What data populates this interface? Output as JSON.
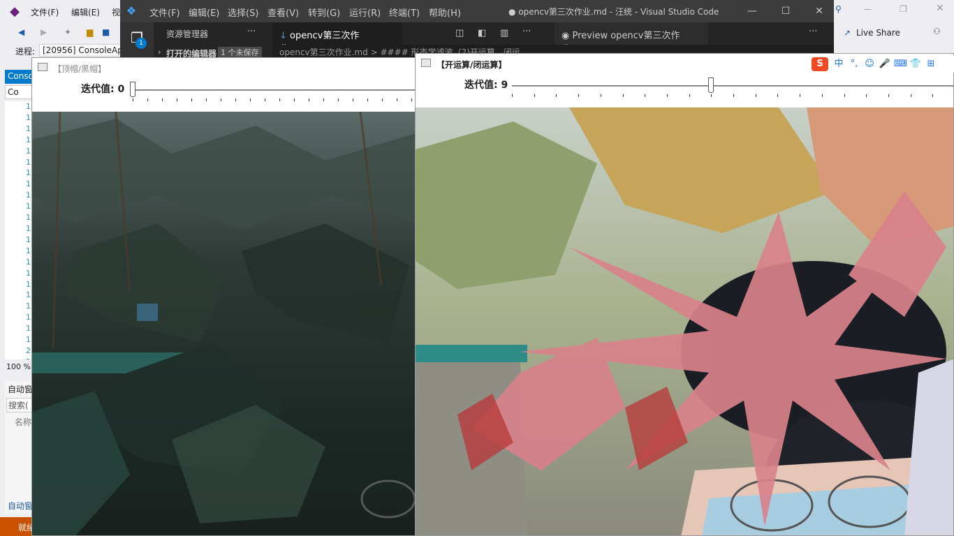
{
  "vs": {
    "menu": [
      "文件(F)",
      "编辑(E)",
      "视"
    ],
    "progress_label": "进程:",
    "process_value": "[20956] ConsoleAp",
    "left_tab": "Conso",
    "left_sub": "Co",
    "line_numbers": [
      "1",
      "1",
      "1",
      "1",
      "1",
      "1",
      "1",
      "1",
      "1",
      "1",
      "1",
      "1",
      "1",
      "1",
      "1",
      "1",
      "1",
      "1",
      "1",
      "1",
      "1",
      "1",
      "2",
      "2"
    ],
    "zoom": "100 %",
    "auto_title": "自动窗",
    "search_placeholder": "搜索(",
    "name_col": "名称",
    "auto_bottom": "自动窗",
    "status_text": "就绪",
    "live_share": "Live Share"
  },
  "vscode": {
    "menu": [
      "文件(F)",
      "编辑(E)",
      "选择(S)",
      "查看(V)",
      "转到(G)",
      "运行(R)",
      "终端(T)",
      "帮助(H)"
    ],
    "window_title": "● opencv第三次作业.md - 汪统 - Visual Studio Code",
    "explorer_label": "资源管理器",
    "open_editors": "打开的编辑器",
    "unsaved_badge": "1 个未保存",
    "activity_badge": "1",
    "tab_active": "opencv第三次作业.md",
    "tab_preview": "Preview opencv第三次作业.md",
    "breadcrumb": "opencv第三次作业.md  >  #### 形态学滤波（2)开运算、闭运",
    "more": "···"
  },
  "windows": {
    "left": {
      "title": "【顶帽/黑帽】",
      "trackbar_label": "迭代值: 0",
      "value": 0,
      "max": 20
    },
    "right": {
      "title": "【开运算/闭运算】",
      "trackbar_label": "迭代值: 9",
      "value": 9,
      "max": 20
    }
  },
  "ime": {
    "items": [
      "S",
      "中",
      "°,",
      "☺",
      "🎤",
      "⌨",
      "👕",
      "⊞"
    ]
  },
  "colors": {
    "vs_status": "#ca5100",
    "vs_accent": "#007acc",
    "vscode_titlebar": "#3c3c3c",
    "vscode_editor": "#1e1e1e"
  }
}
